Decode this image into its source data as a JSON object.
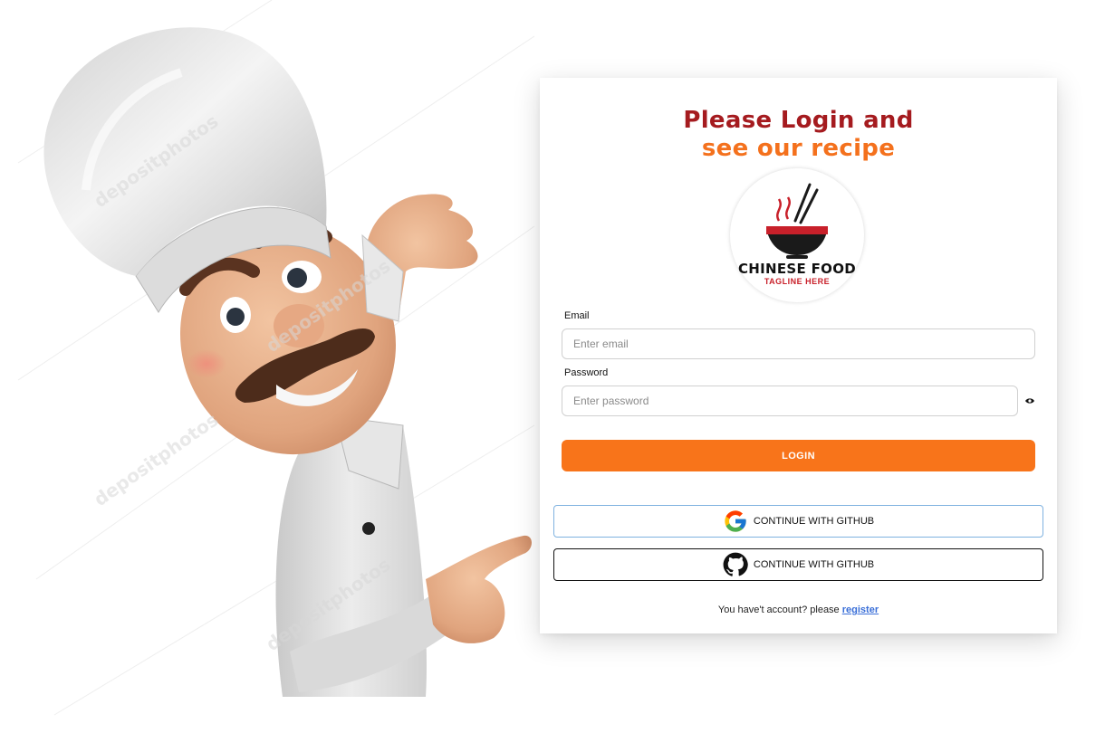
{
  "header": {
    "title_line1": "Please Login and",
    "title_line2": "see our recipe"
  },
  "logo": {
    "brand": "CHINESE FOOD",
    "tagline": "TAGLINE HERE"
  },
  "form": {
    "email_label": "Email",
    "email_placeholder": "Enter email",
    "email_value": "",
    "password_label": "Password",
    "password_placeholder": "Enter password",
    "password_value": "",
    "password_toggle_icon": "eye-icon",
    "login_label": "LOGIN"
  },
  "social": {
    "google_label": "CONTINUE WITH GITHUB",
    "google_icon": "google-icon",
    "github_label": "CONTINUE WITH GITHUB",
    "github_icon": "github-icon"
  },
  "footer": {
    "prompt": "You have't account? please",
    "register_link": "register"
  },
  "illustration": {
    "subject": "chef-illustration",
    "watermark": "depositphotos"
  },
  "colors": {
    "accent": "#f8741a",
    "title_primary": "#a51b1f",
    "title_secondary": "#f4711d",
    "link": "#3a6fd8"
  }
}
